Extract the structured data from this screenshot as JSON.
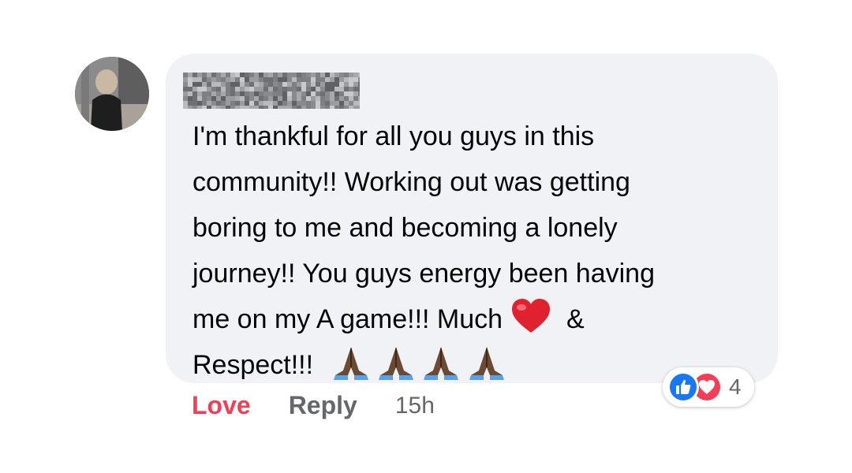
{
  "comment": {
    "author_name_blurred": "",
    "text_lines": [
      "I'm thankful for all you guys in this",
      "community!! Working out was getting",
      "boring to me and becoming a lonely",
      "journey!! You guys energy been having",
      "me on my A game!!! Much",
      "& ",
      "Respect!!!"
    ],
    "emojis": [
      "red-heart-icon",
      "folded-hands-icon",
      "folded-hands-icon",
      "folded-hands-icon",
      "folded-hands-icon"
    ]
  },
  "reactions": {
    "icons": [
      "like-icon",
      "love-icon"
    ],
    "count": "4",
    "colors": {
      "like": "#1877f2",
      "love": "#f33e58"
    }
  },
  "actions": {
    "love_label": "Love",
    "reply_label": "Reply",
    "timestamp": "15h"
  },
  "colors": {
    "bubble": "#f0f2f5",
    "secondary_text": "#65676b",
    "love_active": "#f33e58"
  }
}
